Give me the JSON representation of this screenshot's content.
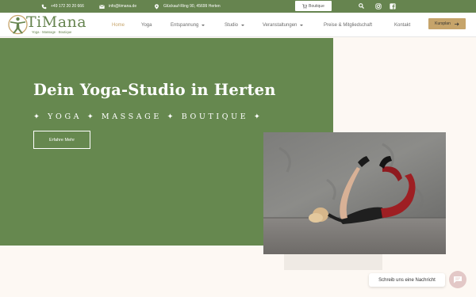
{
  "topbar": {
    "phone": "+49 172 20 20 666",
    "email": "info@timana.de",
    "address": "Glückauf-Ring 90, 45699 Herten",
    "shop_label": "Boutique"
  },
  "logo": {
    "name": "TiMana",
    "tagline": "Yoga · Massage · Boutique"
  },
  "nav": {
    "items": [
      {
        "label": "Home",
        "active": true
      },
      {
        "label": "Yoga"
      },
      {
        "label": "Entspannung",
        "dropdown": true
      },
      {
        "label": "Studio",
        "dropdown": true
      },
      {
        "label": "Veranstaltungen",
        "dropdown": true
      },
      {
        "label": "Preise & Mitgliedschaft"
      },
      {
        "label": "Kontakt"
      }
    ],
    "cta": "Kursplan"
  },
  "hero": {
    "title": "Dein Yoga-Studio in Herten",
    "subtitle": "✦ YOGA ✦ MASSAGE ✦ BOUTIQUE ✦",
    "button": "Erfahre Mehr"
  },
  "chat": {
    "bubble": "Schreib uns eine Nachricht"
  },
  "colors": {
    "brand_green": "#66844f",
    "accent_gold": "#c6a46a",
    "background": "#fdf8f3"
  }
}
